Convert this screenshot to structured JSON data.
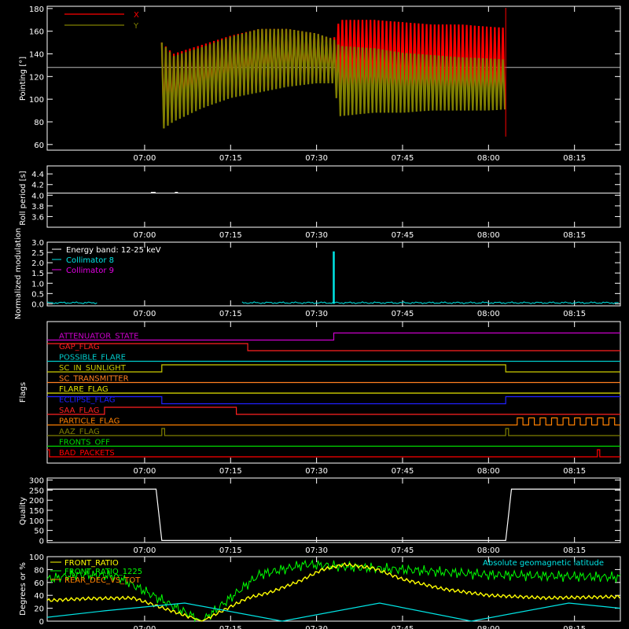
{
  "chart_data": [
    {
      "type": "line",
      "ylabel": "Pointing [°]",
      "ylim": [
        55,
        182
      ],
      "yticks": [
        60,
        80,
        100,
        120,
        140,
        160,
        180
      ],
      "xlim": [
        "06:43",
        "08:23"
      ],
      "xticks": [
        "07:00",
        "07:15",
        "07:30",
        "07:45",
        "08:00",
        "08:15"
      ],
      "reference_line": 128,
      "series": [
        {
          "name": "X",
          "color": "#ff0000",
          "data_start": "07:03",
          "data_end": "08:03",
          "envelope": {
            "x": [
              "07:03",
              "07:05",
              "07:10",
              "07:15",
              "07:20",
              "07:25",
              "07:30",
              "07:33",
              "07:34",
              "07:40",
              "07:45",
              "07:50",
              "07:55",
              "08:00",
              "08:03"
            ],
            "max": [
              150,
              140,
              148,
              156,
              162,
              162,
              158,
              153,
              170,
              170,
              168,
              166,
              166,
              164,
              163
            ],
            "min": [
              78,
              84,
              96,
              104,
              108,
              113,
              116,
              116,
              112,
              105,
              100,
              97,
              95,
              94,
              94
            ]
          }
        },
        {
          "name": "Y",
          "color": "#808000",
          "data_start": "07:03",
          "data_end": "08:03",
          "envelope": {
            "x": [
              "07:03",
              "07:05",
              "07:10",
              "07:15",
              "07:20",
              "07:25",
              "07:30",
              "07:33",
              "07:34",
              "07:40",
              "07:45",
              "07:50",
              "07:55",
              "08:00",
              "08:03"
            ],
            "max": [
              150,
              138,
              146,
              155,
              162,
              162,
              158,
              153,
              147,
              145,
              141,
              139,
              137,
              136,
              135
            ],
            "min": [
              73,
              80,
              92,
              101,
              106,
              111,
              114,
              114,
              85,
              88,
              88,
              90,
              90,
              90,
              91
            ]
          }
        }
      ]
    },
    {
      "type": "line",
      "ylabel": "Roll period [s]",
      "ylim": [
        3.4,
        4.55
      ],
      "yticks": [
        3.6,
        3.8,
        4.0,
        4.2,
        4.4
      ],
      "yticklabels": [
        "3.6",
        "3.8",
        "4.0",
        "4.2",
        "4.4"
      ],
      "xlim": [
        "06:43",
        "08:23"
      ],
      "xticks": [
        "07:00",
        "07:15",
        "07:30",
        "07:45",
        "08:00",
        "08:15"
      ],
      "series": [
        {
          "name": "",
          "color": "#ffffff",
          "x": [
            "06:43",
            "08:23"
          ],
          "values": [
            4.04,
            4.04
          ]
        }
      ]
    },
    {
      "type": "line",
      "ylabel": "Normalized modulation",
      "ylim": [
        -0.1,
        3.0
      ],
      "yticks": [
        0.0,
        0.5,
        1.0,
        1.5,
        2.0,
        2.5,
        3.0
      ],
      "yticklabels": [
        "0.0",
        "0.5",
        "1.0",
        "1.5",
        "2.0",
        "2.5",
        "3.0"
      ],
      "xlim": [
        "06:43",
        "08:23"
      ],
      "xticks": [
        "07:00",
        "07:15",
        "07:30",
        "07:45",
        "08:00",
        "08:15"
      ],
      "legend": {
        "title": "Energy band: 12-25 keV",
        "placement": "top-left"
      },
      "series": [
        {
          "name": "Collimator 8",
          "color": "#00e5e5",
          "baseline": 0.05,
          "gap": [
            "06:52",
            "07:17"
          ],
          "spike": {
            "x": "07:33",
            "value": 2.55
          }
        },
        {
          "name": "Collimator 9",
          "color": "#e600e6"
        }
      ]
    },
    {
      "type": "line",
      "ylabel": "Flags",
      "xlim": [
        "06:43",
        "08:23"
      ],
      "xticks": [
        "07:00",
        "07:15",
        "07:30",
        "07:45",
        "08:00",
        "08:15"
      ],
      "series": [
        {
          "name": "ATTENUATOR_STATE",
          "color": "#cc00cc",
          "steps": [
            [
              "06:43",
              0
            ],
            [
              "07:33",
              1
            ]
          ]
        },
        {
          "name": "GAP_FLAG",
          "color": "#ff2020",
          "steps": [
            [
              "06:43",
              1
            ],
            [
              "07:18",
              0
            ]
          ]
        },
        {
          "name": "POSSIBLE_FLARE",
          "color": "#00cccc",
          "steps": [
            [
              "06:43",
              0
            ]
          ]
        },
        {
          "name": "SC_IN_SUNLIGHT",
          "color": "#cccc00",
          "steps": [
            [
              "06:43",
              0
            ],
            [
              "07:03",
              1
            ],
            [
              "08:03",
              0
            ]
          ]
        },
        {
          "name": "SC_TRANSMITTER",
          "color": "#ff7f20",
          "steps": [
            [
              "06:43",
              0
            ]
          ]
        },
        {
          "name": "FLARE_FLAG",
          "color": "#e6e600",
          "steps": [
            [
              "06:43",
              0
            ]
          ]
        },
        {
          "name": "ECLIPSE_FLAG",
          "color": "#2020ff",
          "steps": [
            [
              "06:43",
              1
            ],
            [
              "07:03",
              0
            ],
            [
              "08:03",
              1
            ]
          ]
        },
        {
          "name": "SAA_FLAG",
          "color": "#ff2020",
          "steps": [
            [
              "06:43",
              0
            ],
            [
              "06:53",
              1
            ],
            [
              "07:16",
              0
            ]
          ]
        },
        {
          "name": "PARTICLE_FLAG",
          "color": "#ff8000",
          "steps": [
            [
              "06:43",
              0
            ],
            [
              "08:05",
              1
            ],
            [
              "08:06",
              0
            ],
            [
              "08:07",
              1
            ],
            [
              "08:08",
              0
            ],
            [
              "08:09",
              1
            ],
            [
              "08:10",
              0
            ],
            [
              "08:11",
              1
            ],
            [
              "08:12",
              0
            ],
            [
              "08:13",
              1
            ],
            [
              "08:14",
              0
            ],
            [
              "08:15",
              1
            ],
            [
              "08:16",
              0
            ],
            [
              "08:17",
              1
            ],
            [
              "08:18",
              0
            ],
            [
              "08:19",
              1
            ],
            [
              "08:20",
              0
            ],
            [
              "08:21",
              1
            ],
            [
              "08:22",
              0
            ]
          ]
        },
        {
          "name": "AAZ_FLAG",
          "color": "#808000",
          "steps": [
            [
              "06:43",
              0
            ],
            [
              "07:03",
              1
            ],
            [
              "07:03.5",
              0
            ],
            [
              "08:03",
              1
            ],
            [
              "08:03.5",
              0
            ]
          ]
        },
        {
          "name": "FRONTS_OFF",
          "color": "#00dd00",
          "steps": [
            [
              "06:43",
              0
            ]
          ]
        },
        {
          "name": "BAD_PACKETS",
          "color": "#ff0000",
          "steps": [
            [
              "06:43",
              1
            ],
            [
              "06:43.4",
              0
            ],
            [
              "08:19",
              1
            ],
            [
              "08:19.4",
              0
            ]
          ]
        }
      ]
    },
    {
      "type": "line",
      "ylabel": "Quality",
      "ylim": [
        -10,
        310
      ],
      "yticks": [
        0,
        50,
        100,
        150,
        200,
        250,
        300
      ],
      "xlim": [
        "06:43",
        "08:23"
      ],
      "xticks": [
        "07:00",
        "07:15",
        "07:30",
        "07:45",
        "08:00",
        "08:15"
      ],
      "series": [
        {
          "name": "",
          "color": "#ffffff",
          "x": [
            "06:43",
            "07:02",
            "07:03",
            "08:03",
            "08:04",
            "08:23"
          ],
          "values": [
            255,
            255,
            0,
            0,
            255,
            255
          ]
        }
      ]
    },
    {
      "type": "line",
      "ylabel": "Degrees or %",
      "ylim": [
        0,
        100
      ],
      "yticks": [
        0,
        20,
        40,
        60,
        80,
        100
      ],
      "xlim": [
        "06:43",
        "08:23"
      ],
      "xticks": [
        "07:00",
        "07:15",
        "07:30",
        "07:45",
        "08:00",
        "08:15"
      ],
      "series": [
        {
          "name": "FRONT_RATIO",
          "color": "#ffff00",
          "x": [
            "06:43",
            "06:50",
            "06:58",
            "07:10",
            "07:18",
            "07:22",
            "07:27",
            "07:31",
            "07:35",
            "07:40",
            "07:45",
            "07:52",
            "08:00",
            "08:10",
            "08:23"
          ],
          "values": [
            32,
            35,
            36,
            0,
            36,
            45,
            62,
            80,
            88,
            82,
            65,
            50,
            40,
            36,
            38
          ]
        },
        {
          "name": "FRONT_RATIO_1225",
          "color": "#00ff00",
          "x": [
            "06:43",
            "06:48",
            "06:55",
            "07:10",
            "07:18",
            "07:20",
            "07:28",
            "07:34",
            "07:45",
            "08:00",
            "08:23"
          ],
          "values": [
            65,
            72,
            70,
            0,
            58,
            72,
            88,
            85,
            80,
            72,
            68
          ]
        },
        {
          "name": "REAR_DEC_VS_TOT",
          "color": "#ff8000"
        },
        {
          "name": "Absolute geomagnetic latitude",
          "color": "#00e5e5",
          "x": [
            "06:43",
            "06:53",
            "07:07",
            "07:24",
            "07:41",
            "07:57",
            "08:14",
            "08:23"
          ],
          "values": [
            6,
            16,
            28,
            0,
            28,
            0,
            28,
            20
          ]
        }
      ]
    }
  ]
}
